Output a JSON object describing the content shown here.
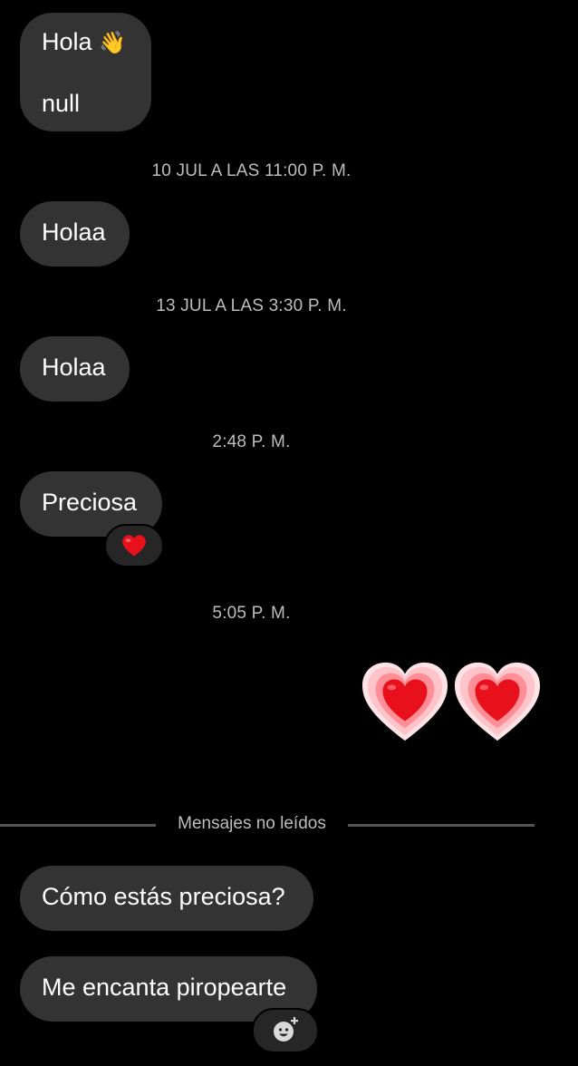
{
  "messages": [
    {
      "id": "m1",
      "line1": "Hola",
      "emoji": "👋",
      "line2": "null"
    },
    {
      "id": "m2",
      "text": "Holaa"
    },
    {
      "id": "m3",
      "text": "Holaa"
    },
    {
      "id": "m4",
      "text": "Preciosa",
      "reaction": "heart"
    },
    {
      "id": "m6",
      "text": "Cómo estás preciosa?"
    },
    {
      "id": "m7",
      "text": "Me encanta piropearte"
    }
  ],
  "timestamps": [
    "10 JUL A LAS 11:00 P. M.",
    "13 JUL A LAS 3:30 P. M.",
    "2:48 P. M.",
    "5:05 P. M."
  ],
  "sent_emoji": [
    "heart-pulse",
    "heart-pulse"
  ],
  "unread_divider": "Mensajes no leídos",
  "colors": {
    "bubble": "#333333",
    "background": "#000000",
    "timestamp": "#bdbdbd",
    "heart": "#e8101b"
  }
}
